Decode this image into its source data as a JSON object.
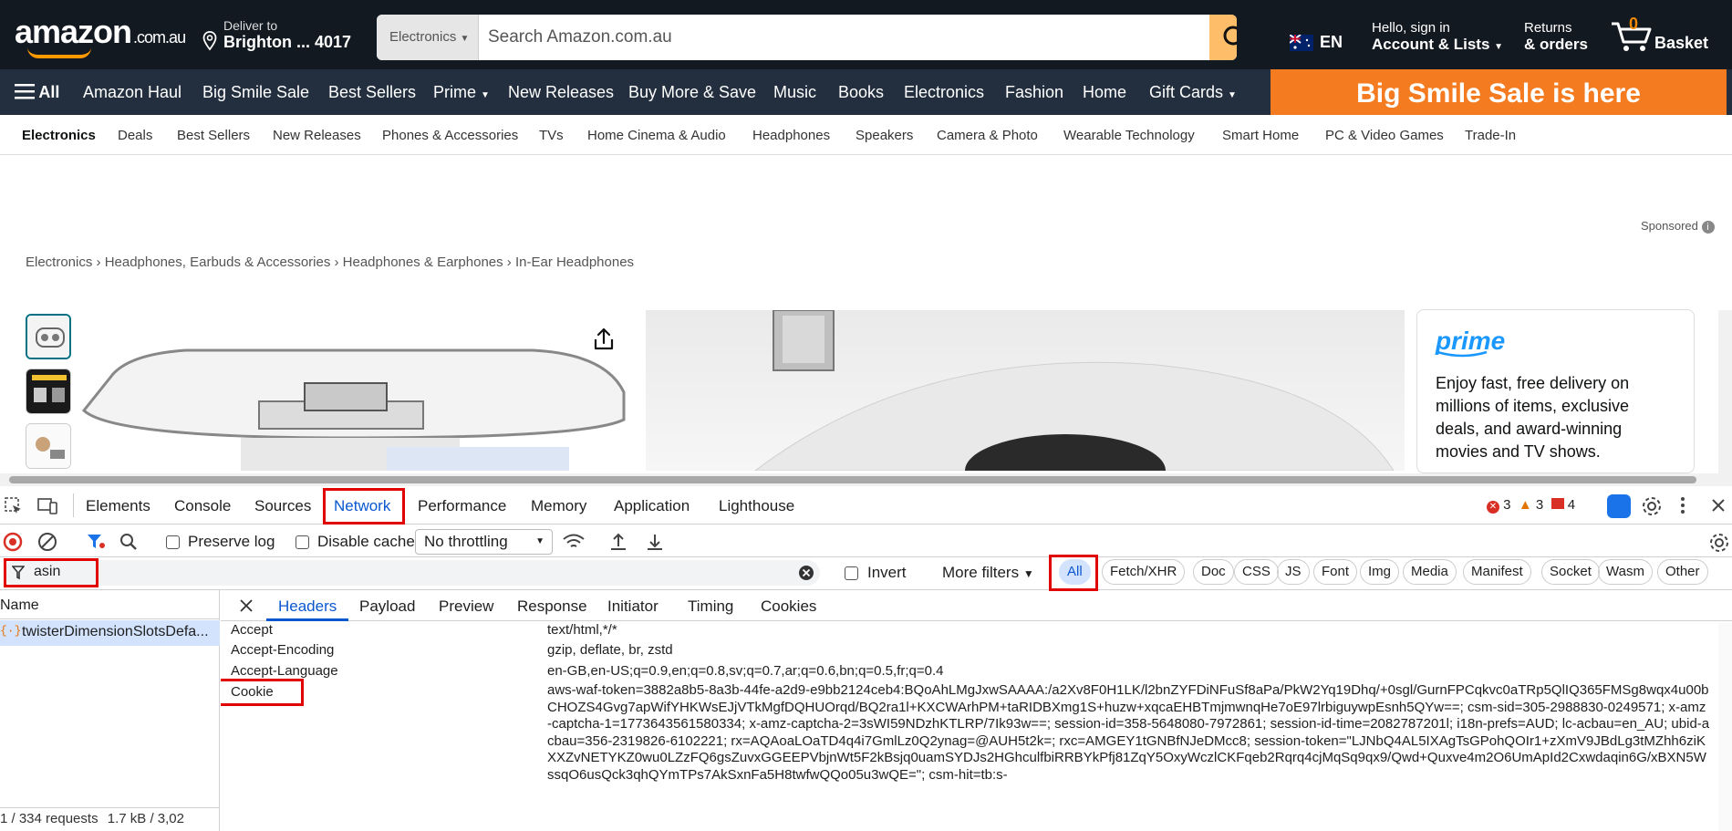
{
  "header": {
    "logo": "amazon",
    "logo_tld": ".com.au",
    "deliver_to": "Deliver to",
    "location": "Brighton ... 4017",
    "search_category": "Electronics",
    "search_placeholder": "Search Amazon.com.au",
    "language": "EN",
    "greeting": "Hello, sign in",
    "account": "Account & Lists",
    "returns": "Returns",
    "orders": "& orders",
    "basket_count": "0",
    "basket": "Basket"
  },
  "nav": {
    "all": "All",
    "items": [
      "Amazon Haul",
      "Big Smile Sale",
      "Best Sellers",
      "Prime",
      "New Releases",
      "Buy More & Save",
      "Music",
      "Books",
      "Electronics",
      "Fashion",
      "Home",
      "Gift Cards"
    ],
    "promo": "Big Smile Sale is here"
  },
  "subnav": {
    "items": [
      "Electronics",
      "Deals",
      "Best Sellers",
      "New Releases",
      "Phones & Accessories",
      "TVs",
      "Home Cinema & Audio",
      "Headphones",
      "Speakers",
      "Camera & Photo",
      "Wearable Technology",
      "Smart Home",
      "PC & Video Games",
      "Trade-In"
    ]
  },
  "page": {
    "sponsored": "Sponsored",
    "breadcrumb": "Electronics › Headphones, Earbuds & Accessories › Headphones & Earphones › In-Ear Headphones",
    "prime_logo": "prime",
    "prime_text": "Enjoy fast, free delivery on millions of items, exclusive deals, and award-winning movies and TV shows."
  },
  "devtools": {
    "tabs": [
      "Elements",
      "Console",
      "Sources",
      "Network",
      "Performance",
      "Memory",
      "Application",
      "Lighthouse"
    ],
    "errors": "3",
    "warnings": "3",
    "issues": "4",
    "preserve_log": "Preserve log",
    "disable_cache": "Disable cache",
    "throttling": "No throttling",
    "filter_value": "asin",
    "invert": "Invert",
    "more_filters": "More filters",
    "type_filters": [
      "All",
      "Fetch/XHR",
      "Doc",
      "CSS",
      "JS",
      "Font",
      "Img",
      "Media",
      "Manifest",
      "Socket",
      "Wasm",
      "Other"
    ],
    "name_header": "Name",
    "request_name": "twisterDimensionSlotsDefa...",
    "status": "1 / 334 requests",
    "transfer": "1.7 kB / 3,02",
    "detail_tabs": [
      "Headers",
      "Payload",
      "Preview",
      "Response",
      "Initiator",
      "Timing",
      "Cookies"
    ],
    "headers": [
      {
        "key": "Accept",
        "value": "text/html,*/*"
      },
      {
        "key": "Accept-Encoding",
        "value": "gzip, deflate, br, zstd"
      },
      {
        "key": "Accept-Language",
        "value": "en-GB,en-US;q=0.9,en;q=0.8,sv;q=0.7,ar;q=0.6,bn;q=0.5,fr;q=0.4"
      },
      {
        "key": "Cookie",
        "value": "aws-waf-token=3882a8b5-8a3b-44fe-a2d9-e9bb2124ceb4:BQoAhLMgJxwSAAAA:/a2Xv8F0H1LK/l2bnZYFDiNFuSf8aPa/PkW2Yq19Dhq/+0sgl/GurnFPCqkvc0aTRp5QlIQ365FMSg8wqx4u00bCHOZS4Gvg7apWifYHKWsEJjVTkMgfDQHUOrqd/BQ2ra1l+KXCWArhPM+taRIDBXmg1S+huzw+xqcaEHBTmjmwnqHe7oE97lrbiguywpEsnh5QYw==; csm-sid=305-2988830-0249571; x-amz-captcha-1=1773643561580334; x-amz-captcha-2=3sWI59NDzhKTLRP/7Ik93w==; session-id=358-5648080-7972861; session-id-time=2082787201l; i18n-prefs=AUD; lc-acbau=en_AU; ubid-acbau=356-2319826-6102221; rx=AQAoaLOaTD4q4i7GmlLz0Q2ynag=@AUH5t2k=; rxc=AMGEY1tGNBfNJeDMcc8; session-token=\"LJNbQ4AL5IXAgTsGPohQOIr1+zXmV9JBdLg3tMZhh6ziKXXZvNETYKZ0wu0LZzFQ6gsZuvxGGEEPVbjnWt5F2kBsjq0uamSYDJs2HGhculfbiRRBYkPfj81ZqY5OxyWczlCKFqeb2Rqrq4cjMqSq9qx9/Qwd+Quxve4m2O6UmApId2Cxwdaqin6G/xBXN5WssqO6usQck3qhQYmTPs7AkSxnFa5H8twfwQQo05u3wQE=\"; csm-hit=tb:s-"
      }
    ]
  }
}
